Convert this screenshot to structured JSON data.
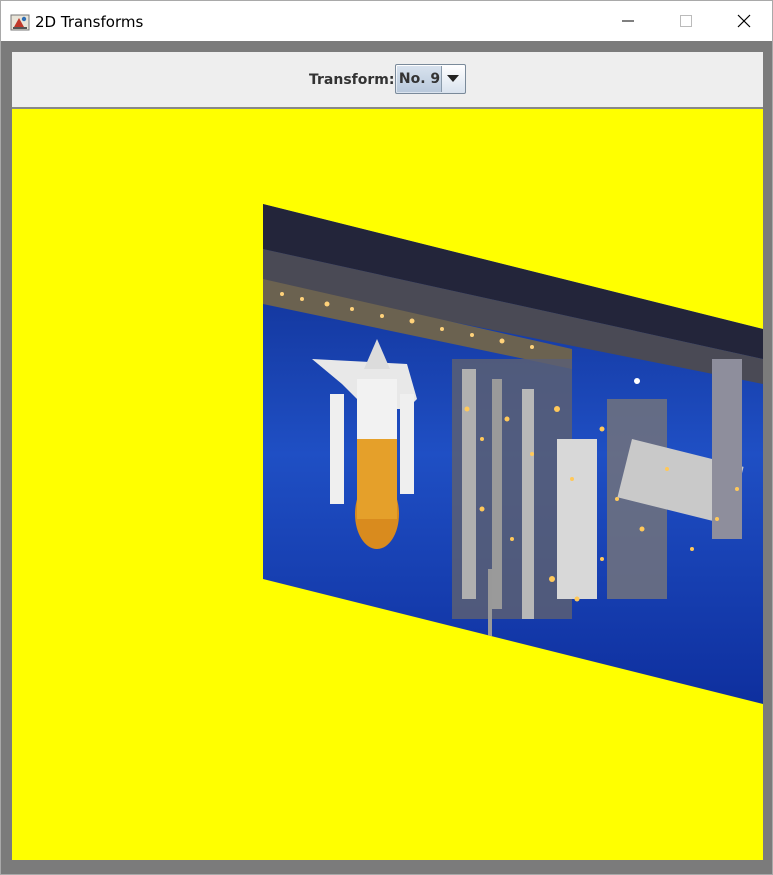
{
  "window": {
    "title": "2D Transforms",
    "controls": {
      "minimize_icon": "minimize-icon",
      "maximize_icon": "maximize-icon",
      "close_icon": "close-icon"
    }
  },
  "toolbar": {
    "transform_label": "Transform:",
    "transform_selected": "No. 9"
  },
  "canvas": {
    "background_color": "#ffff00",
    "image_description_colors": {
      "sky": "#1f4fc4",
      "tower": "#a8a8a8",
      "lights": "#ffcc55"
    }
  }
}
